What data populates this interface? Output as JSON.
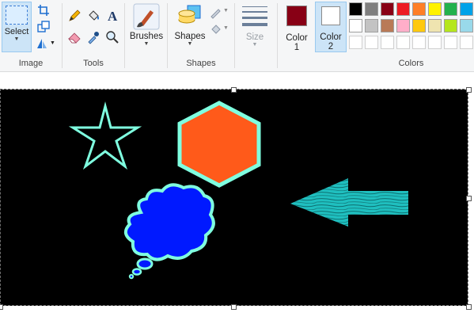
{
  "ribbon": {
    "image_group": {
      "label": "Image",
      "select_label": "Select"
    },
    "tools_group": {
      "label": "Tools"
    },
    "brushes": {
      "label": "Brushes"
    },
    "shapes_group": {
      "label": "Shapes",
      "shapes_label": "Shapes"
    },
    "size": {
      "label": "Size"
    },
    "color1": {
      "label": "Color",
      "number": "1",
      "color": "#880015"
    },
    "color2": {
      "label": "Color",
      "number": "2",
      "color": "#ffffff"
    },
    "colors_group": {
      "label": "Colors"
    }
  },
  "palette": {
    "row1": [
      "#000000",
      "#7f7f7f",
      "#880015",
      "#ed1c24",
      "#ff7f27",
      "#fff200",
      "#22b14c",
      "#00a2e8"
    ],
    "row2": [
      "#ffffff",
      "#c3c3c3",
      "#b97a57",
      "#ffaec9",
      "#ffc90e",
      "#efe4b0",
      "#b5e61d",
      "#99d9ea"
    ],
    "row3": [
      "#ffffff",
      "#ffffff",
      "#ffffff",
      "#ffffff",
      "#ffffff",
      "#ffffff",
      "#ffffff",
      "#ffffff"
    ]
  },
  "canvas": {
    "background": "#000000",
    "shapes": [
      "star",
      "hexagon",
      "thought-bubble",
      "arrow"
    ],
    "outline_color": "#7fffe0",
    "hexagon_fill": "#ff5a1a",
    "bubble_fill": "#0019ff",
    "arrow_color": "#1fbfbf"
  }
}
